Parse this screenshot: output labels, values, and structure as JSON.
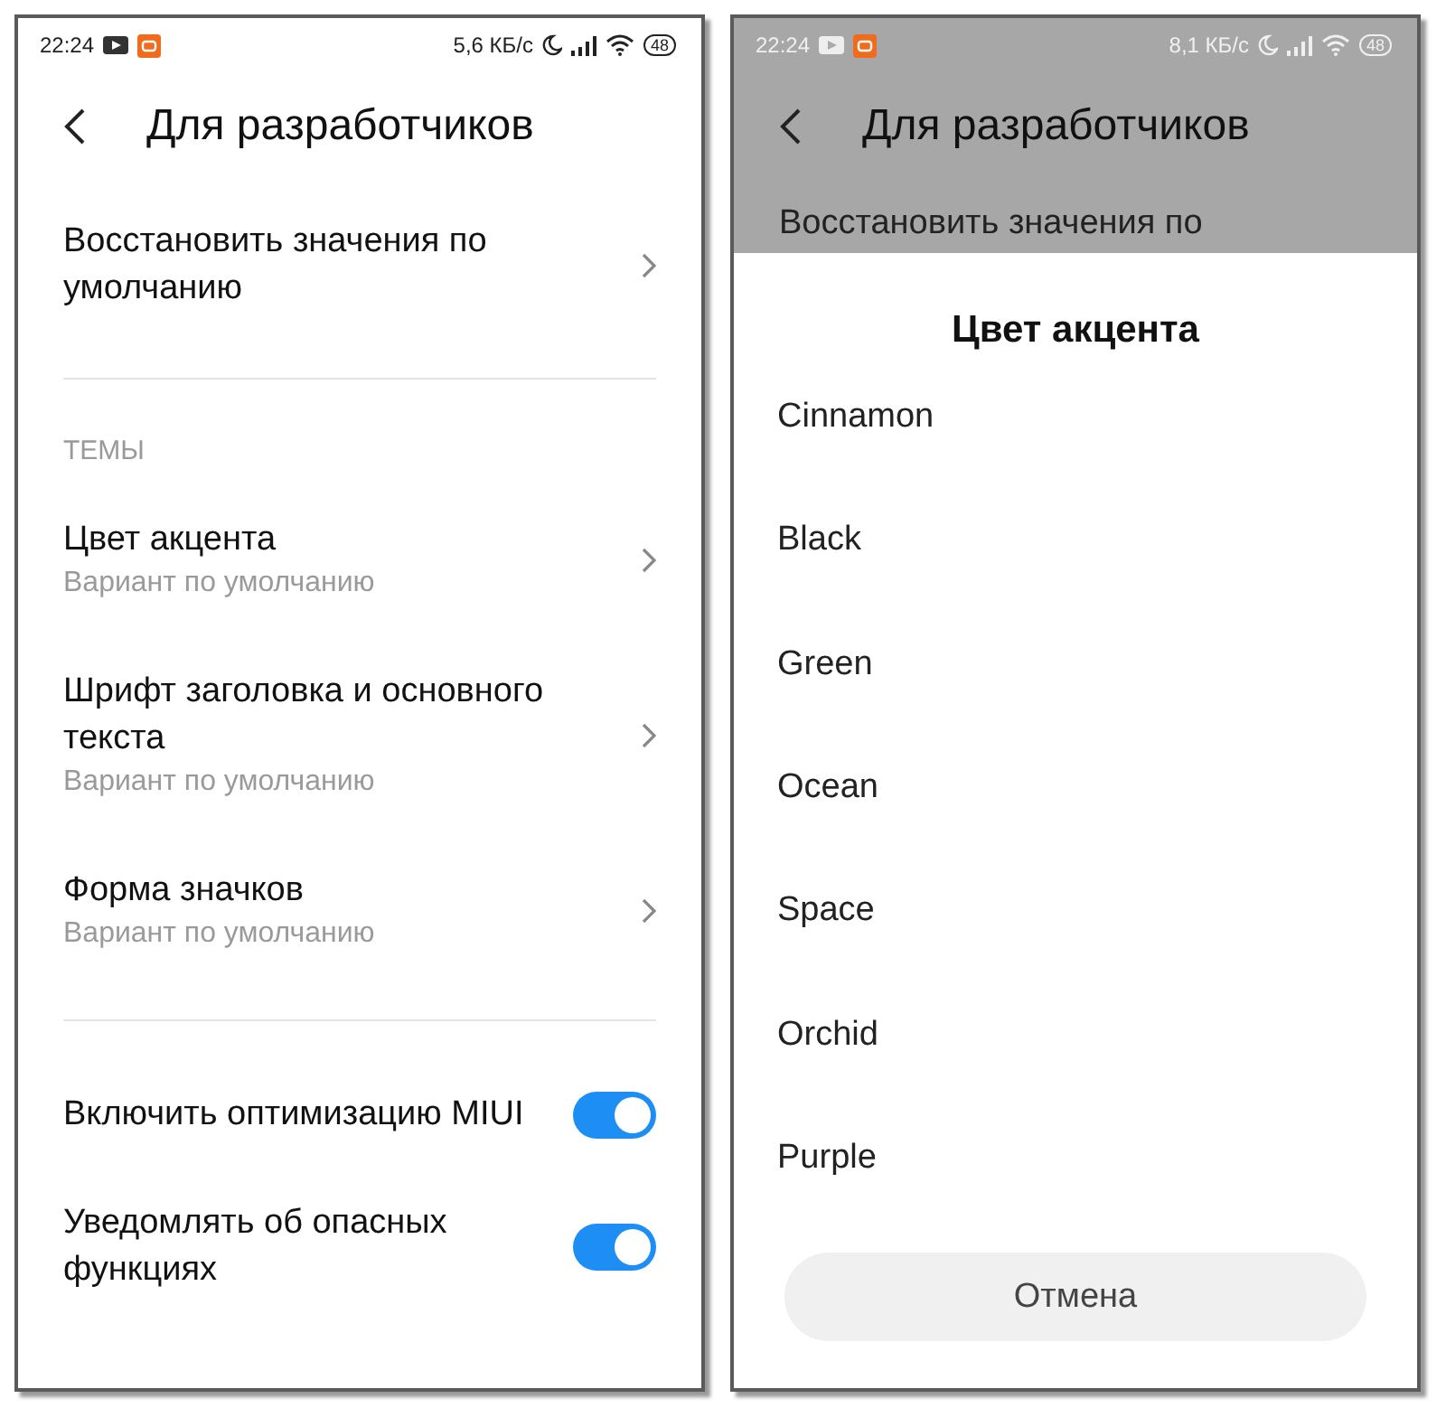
{
  "left_screen": {
    "status_bar": {
      "time": "22:24",
      "speed": "5,6 КБ/с",
      "battery": "48"
    },
    "title": "Для разработчиков",
    "sections": [
      {
        "items": [
          {
            "kind": "link",
            "title": "Восстановить значения по умолчанию"
          }
        ]
      },
      {
        "header": "ТЕМЫ",
        "items": [
          {
            "kind": "link",
            "title": "Цвет акцента",
            "subtitle": "Вариант по умолчанию"
          },
          {
            "kind": "link",
            "title": "Шрифт заголовка и основного текста",
            "subtitle": "Вариант по умолчанию"
          },
          {
            "kind": "link",
            "title": "Форма значков",
            "subtitle": "Вариант по умолчанию"
          }
        ]
      },
      {
        "items": [
          {
            "kind": "toggle",
            "title": "Включить оптимизацию MIUI",
            "on": true
          },
          {
            "kind": "toggle",
            "title": "Уведомлять об опасных функциях",
            "on": true
          }
        ]
      }
    ]
  },
  "right_screen": {
    "status_bar": {
      "time": "22:24",
      "speed": "8,1 КБ/с",
      "battery": "48"
    },
    "title": "Для разработчиков",
    "background_item": "Восстановить значения по",
    "dialog": {
      "title": "Цвет акцента",
      "options": [
        "Cinnamon",
        "Black",
        "Green",
        "Ocean",
        "Space",
        "Orchid",
        "Purple"
      ],
      "cancel": "Отмена"
    }
  }
}
